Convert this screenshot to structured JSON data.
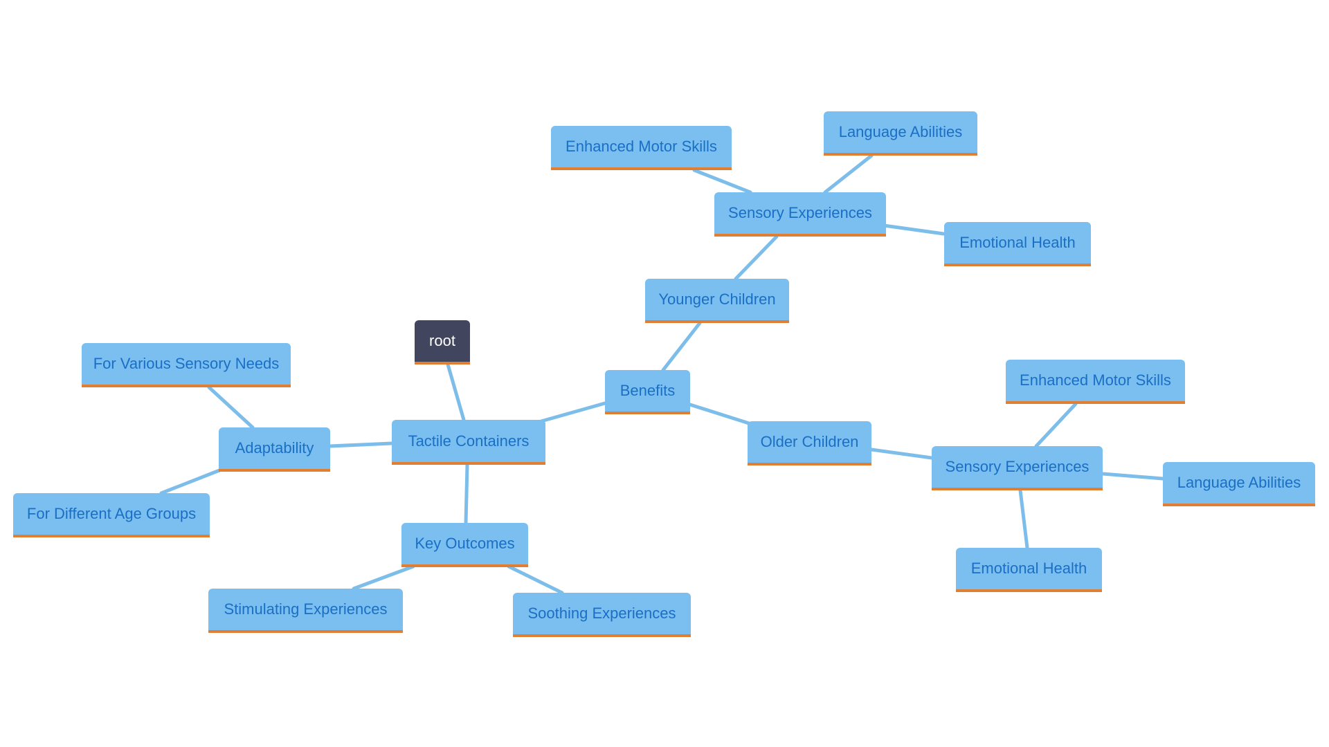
{
  "diagram": {
    "type": "mindmap",
    "colors": {
      "node_fill": "#7bbff0",
      "node_text": "#1a6fc4",
      "node_underline": "#e07f34",
      "edge": "#7dbdea",
      "root_fill": "#41465e",
      "root_text": "#ffffff"
    },
    "nodes": [
      {
        "id": "root",
        "label": "root"
      },
      {
        "id": "tactile",
        "label": "Tactile Containers"
      },
      {
        "id": "benefits",
        "label": "Benefits"
      },
      {
        "id": "younger",
        "label": "Younger Children"
      },
      {
        "id": "sens_y",
        "label": "Sensory Experiences"
      },
      {
        "id": "motor_y",
        "label": "Enhanced Motor Skills"
      },
      {
        "id": "lang_y",
        "label": "Language Abilities"
      },
      {
        "id": "emo_y",
        "label": "Emotional Health"
      },
      {
        "id": "older",
        "label": "Older Children"
      },
      {
        "id": "sens_o",
        "label": "Sensory Experiences"
      },
      {
        "id": "motor_o",
        "label": "Enhanced Motor Skills"
      },
      {
        "id": "lang_o",
        "label": "Language Abilities"
      },
      {
        "id": "emo_o",
        "label": "Emotional Health"
      },
      {
        "id": "adapt",
        "label": "Adaptability"
      },
      {
        "id": "sensory_needs",
        "label": "For Various Sensory Needs"
      },
      {
        "id": "age_groups",
        "label": "For Different Age Groups"
      },
      {
        "id": "outcomes",
        "label": "Key Outcomes"
      },
      {
        "id": "stimulating",
        "label": "Stimulating Experiences"
      },
      {
        "id": "soothing",
        "label": "Soothing Experiences"
      }
    ],
    "edges": [
      [
        "root",
        "tactile"
      ],
      [
        "tactile",
        "benefits"
      ],
      [
        "benefits",
        "younger"
      ],
      [
        "younger",
        "sens_y"
      ],
      [
        "sens_y",
        "motor_y"
      ],
      [
        "sens_y",
        "lang_y"
      ],
      [
        "sens_y",
        "emo_y"
      ],
      [
        "benefits",
        "older"
      ],
      [
        "older",
        "sens_o"
      ],
      [
        "sens_o",
        "motor_o"
      ],
      [
        "sens_o",
        "lang_o"
      ],
      [
        "sens_o",
        "emo_o"
      ],
      [
        "tactile",
        "adapt"
      ],
      [
        "adapt",
        "sensory_needs"
      ],
      [
        "adapt",
        "age_groups"
      ],
      [
        "tactile",
        "outcomes"
      ],
      [
        "outcomes",
        "stimulating"
      ],
      [
        "outcomes",
        "soothing"
      ]
    ]
  }
}
